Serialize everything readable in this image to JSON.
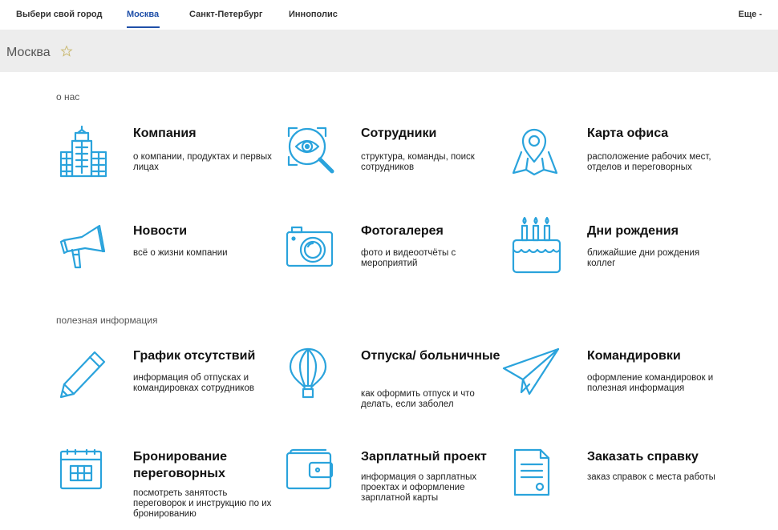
{
  "nav": {
    "choose_label": "Выбери свой город",
    "cities": [
      "Москва",
      "Санкт-Петербург",
      "Иннополис"
    ],
    "more_label": "Еще -"
  },
  "header": {
    "title": "Москва"
  },
  "sections": {
    "about": "о нас",
    "useful": "полезная информация"
  },
  "cards": [
    {
      "title": "Компания",
      "desc": "о компании, продуктах и первых лицах",
      "icon": "building-icon"
    },
    {
      "title": "Сотрудники",
      "desc": "структура, команды, поиск сотрудников",
      "icon": "eye-search-icon"
    },
    {
      "title": "Карта офиса",
      "desc": "расположение рабочих мест, отделов и переговорных",
      "icon": "map-pin-icon"
    },
    {
      "title": "Новости",
      "desc": "всё о жизни компании",
      "icon": "megaphone-icon"
    },
    {
      "title": "Фотогалерея",
      "desc": "фото и видеоотчёты с мероприятий",
      "icon": "camera-icon"
    },
    {
      "title": "Дни рождения",
      "desc": "ближайшие дни рождения коллег",
      "icon": "cake-icon"
    },
    {
      "title": "График отсутствий",
      "desc": "информация об отпусках и командировках сотрудников",
      "icon": "pencil-icon"
    },
    {
      "title": "Отпуска/ больничные",
      "desc": "как оформить отпуск и что делать, если заболел",
      "icon": "balloon-icon"
    },
    {
      "title": "Командировки",
      "desc": "оформление командировок и полезная информация",
      "icon": "paper-plane-icon"
    },
    {
      "title": "Бронирование переговорных",
      "desc": "посмотреть занятость переговорок и инструкцию по их бронированию",
      "icon": "calendar-icon"
    },
    {
      "title": "Зарплатный проект",
      "desc": "информация о зарплатных проектах и оформление зарплатной карты",
      "icon": "wallet-icon"
    },
    {
      "title": "Заказать справку",
      "desc": "заказ справок с места работы",
      "icon": "document-icon"
    }
  ],
  "colors": {
    "accent": "#2aa3dc",
    "nav_active": "#1f4fa8",
    "band": "#ededed"
  }
}
